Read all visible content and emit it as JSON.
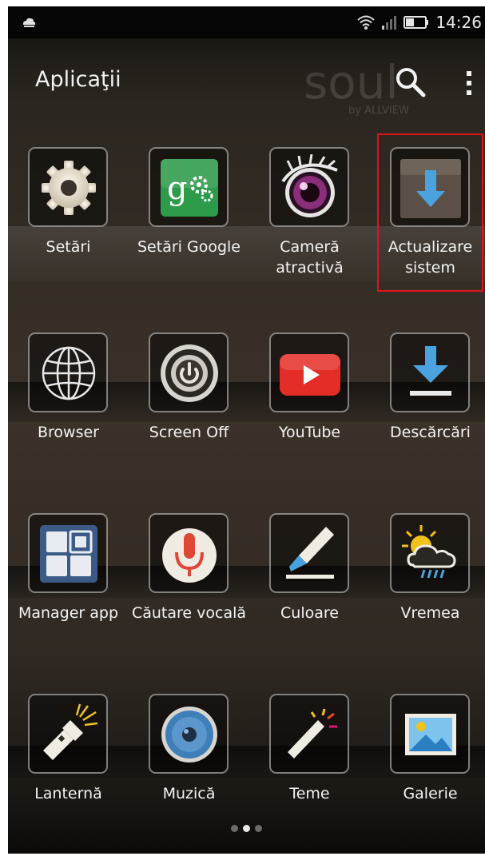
{
  "status_bar": {
    "time": "14:26"
  },
  "app_bar": {
    "title": "Aplicaţii",
    "brand": "soul",
    "brand_sub": "by ALLVIEW"
  },
  "apps": [
    {
      "label": "Setări",
      "icon": "settings-gear-icon"
    },
    {
      "label": "Setări Google",
      "icon": "google-settings-icon"
    },
    {
      "label": "Cameră atractivă",
      "icon": "camera-eye-icon"
    },
    {
      "label": "Actualizare sistem",
      "icon": "system-update-icon"
    },
    {
      "label": "Browser",
      "icon": "globe-icon"
    },
    {
      "label": "Screen Off",
      "icon": "power-icon"
    },
    {
      "label": "YouTube",
      "icon": "youtube-icon"
    },
    {
      "label": "Descărcări",
      "icon": "download-icon"
    },
    {
      "label": "Manager app",
      "icon": "app-manager-icon"
    },
    {
      "label": "Căutare vocală",
      "icon": "microphone-icon"
    },
    {
      "label": "Culoare",
      "icon": "brush-icon"
    },
    {
      "label": "Vremea",
      "icon": "weather-icon"
    },
    {
      "label": "Lanternă",
      "icon": "flashlight-icon"
    },
    {
      "label": "Muzică",
      "icon": "speaker-icon"
    },
    {
      "label": "Teme",
      "icon": "magic-wand-icon"
    },
    {
      "label": "Galerie",
      "icon": "gallery-icon"
    }
  ],
  "pager": {
    "pages": 3,
    "current": 2
  },
  "colors": {
    "highlight": "#e0141b",
    "google_green": "#2e9b4a",
    "youtube_red": "#e52d27",
    "update_blue": "#4aa3df"
  }
}
